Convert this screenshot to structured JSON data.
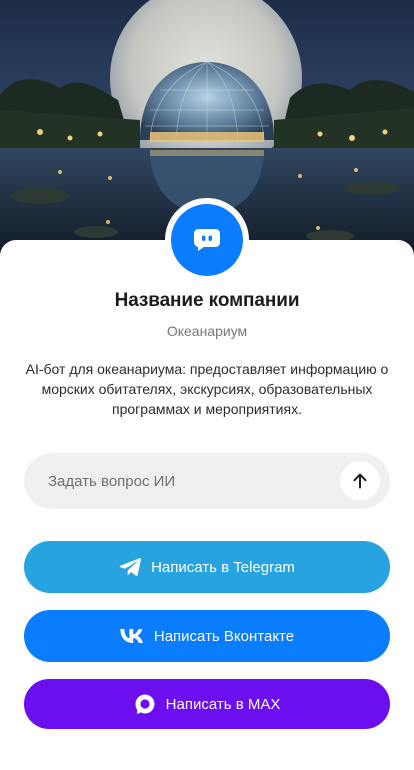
{
  "company": {
    "name": "Название компании",
    "category": "Океанариум",
    "description": "AI-бот для океанариума: предоставляет информацию о морских обитателях, экскурсиях, образовательных программах и мероприятиях."
  },
  "ask": {
    "placeholder": "Задать вопрос ИИ",
    "value": ""
  },
  "buttons": {
    "telegram": "Написать в Telegram",
    "vk": "Написать Вконтакте",
    "max": "Написать в MAX"
  },
  "colors": {
    "avatar": "#0a7cff",
    "telegram": "#27a4e0",
    "vk": "#0a7cff",
    "max": "#6b0ff0"
  },
  "icons": {
    "avatar": "chat-bot-icon",
    "send": "arrow-up-icon",
    "telegram": "telegram-icon",
    "vk": "vk-icon",
    "max": "max-icon"
  }
}
